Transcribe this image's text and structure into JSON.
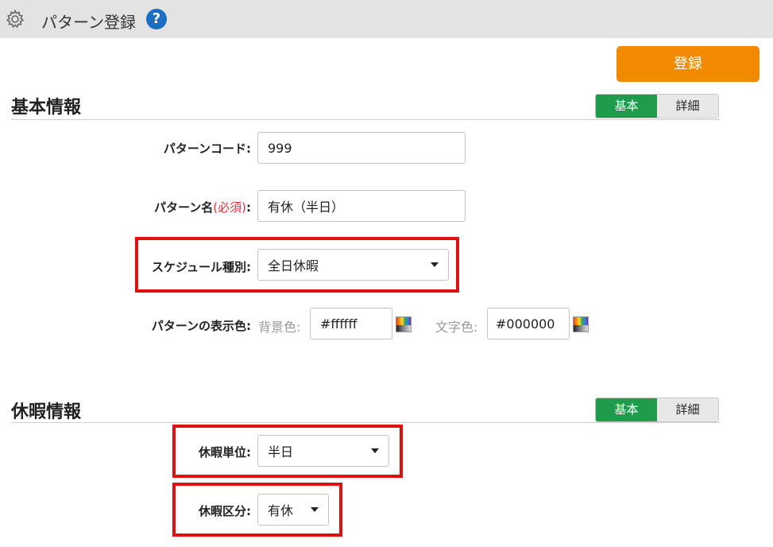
{
  "header": {
    "title": "パターン登録",
    "help_symbol": "?"
  },
  "toolbar": {
    "register_label": "登録"
  },
  "toggle": {
    "basic": "基本",
    "detail": "詳細"
  },
  "section_basic": {
    "title": "基本情報",
    "pattern_code": {
      "label": "パターンコード:",
      "value": "999"
    },
    "pattern_name": {
      "label": "パターン名",
      "required": "(必須)",
      "colon": ":",
      "value": "有休（半日）"
    },
    "schedule_type": {
      "label": "スケジュール種別:",
      "value": "全日休暇"
    },
    "display_color": {
      "label": "パターンの表示色:",
      "bg_label": "背景色:",
      "bg_value": "#ffffff",
      "text_label": "文字色:",
      "text_value": "#000000"
    }
  },
  "section_leave": {
    "title": "休暇情報",
    "leave_unit": {
      "label": "休暇単位:",
      "value": "半日"
    },
    "leave_type": {
      "label": "休暇区分:",
      "value": "有休"
    }
  },
  "colors": {
    "accent_orange": "#f28a00",
    "toggle_green": "#1e9c4c",
    "highlight_red": "#e01010",
    "help_blue": "#1a6fc4"
  }
}
